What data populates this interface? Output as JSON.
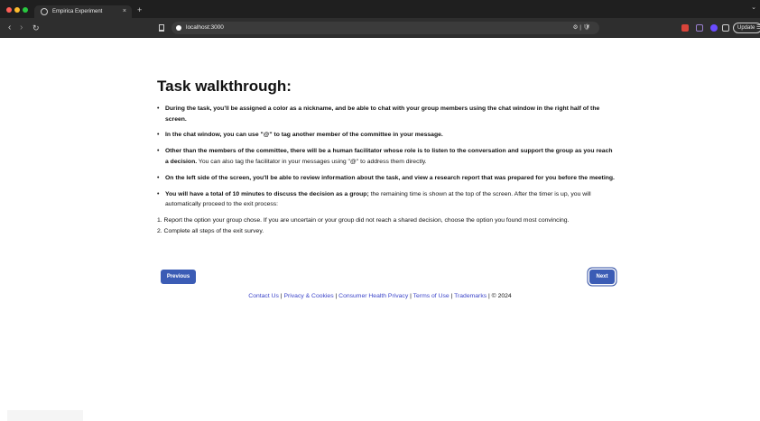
{
  "browser": {
    "tab_title": "Empirica Experiment",
    "tab_close": "×",
    "new_tab": "+",
    "url": "localhost:3000",
    "url_right": "⚙ | 🛡",
    "update_label": "Update ☰",
    "window_chevron": "⌄",
    "nav_back": "‹",
    "nav_forward": "›",
    "nav_reload": "↻"
  },
  "page": {
    "heading": "Task walkthrough:",
    "bullets": [
      {
        "bold": "During the task, you'll be assigned a color as a nickname, and be able to chat with your group members using the chat window in the right half of the screen.",
        "rest": ""
      },
      {
        "bold": "In the chat window, you can use \"@\" to tag another member of the committee in your message.",
        "rest": ""
      },
      {
        "bold": "Other than the members of the committee, there will be a human facilitator whose role is to listen to the conversation and support the group as you reach a decision.",
        "rest": " You can also tag the facilitator in your messages using \"@\" to address them directly."
      },
      {
        "bold": "On the left side of the screen, you'll be able to review information about the task, and view a research report that was prepared for you before the meeting.",
        "rest": ""
      },
      {
        "bold": "You will have a total of 10 minutes to discuss the decision as a group;",
        "rest": " the remaining time is shown at the top of the screen. After the timer is up, you will automatically proceed to the exit process:"
      }
    ],
    "steps": [
      "1. Report the option your group chose. If you are uncertain or your group did not reach a shared decision, choose the option you found most convincing.",
      "2. Complete all steps of the exit survey."
    ],
    "previous_label": "Previous",
    "next_label": "Next"
  },
  "footer": {
    "links": [
      "Contact Us",
      "Privacy & Cookies",
      "Consumer Health Privacy",
      "Terms of Use",
      "Trademarks"
    ],
    "separator": " | ",
    "copyright": "© 2024"
  },
  "colors": {
    "button": "#3b5cb5",
    "link": "#3b44c9",
    "chrome": "#2e2e2e"
  }
}
